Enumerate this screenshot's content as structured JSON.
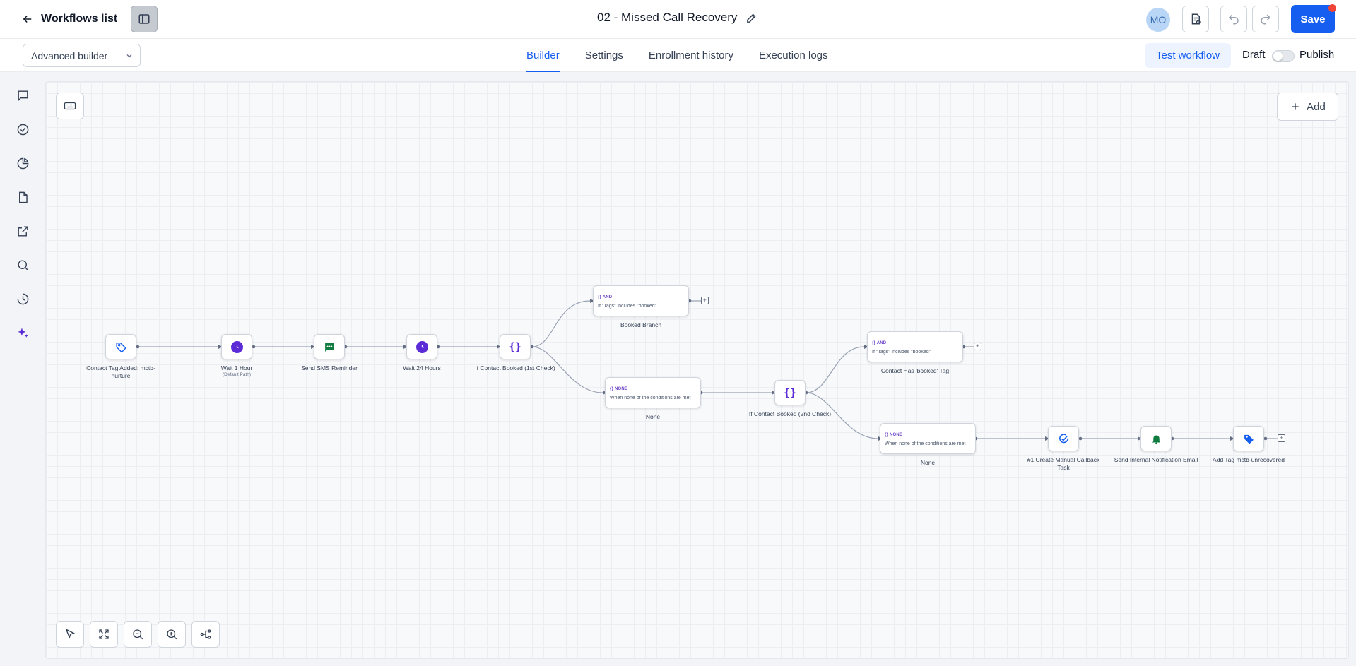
{
  "header": {
    "back_label": "Workflows list",
    "workflow_title": "02 - Missed Call Recovery",
    "avatar_initials": "MO",
    "save_label": "Save"
  },
  "subbar": {
    "builder_select": "Advanced builder",
    "tabs": [
      {
        "label": "Builder",
        "active": true
      },
      {
        "label": "Settings",
        "active": false
      },
      {
        "label": "Enrollment history",
        "active": false
      },
      {
        "label": "Execution logs",
        "active": false
      }
    ],
    "test_label": "Test workflow",
    "draft_label": "Draft",
    "publish_label": "Publish",
    "published": false
  },
  "canvas": {
    "add_label": "Add"
  },
  "nodes": {
    "n1": {
      "label": "Contact Tag Added: mctb-nurture",
      "icon": "tag-icon"
    },
    "n2": {
      "label": "Wait 1 Hour",
      "sub": "(Default Path)",
      "icon": "clock-icon"
    },
    "n3": {
      "label": "Send SMS Reminder",
      "icon": "sms-icon"
    },
    "n4": {
      "label": "Wait 24 Hours",
      "icon": "clock-icon"
    },
    "n5": {
      "label": "If Contact Booked (1st Check)",
      "icon": "braces-icon"
    },
    "c1": {
      "badge": "AND",
      "text": "If \"Tags\" includes \"booked\"",
      "label": "Booked Branch"
    },
    "c2": {
      "badge": "NONE",
      "text": "When none of the conditions are met",
      "label": "None"
    },
    "n6": {
      "label": "If Contact Booked (2nd Check)",
      "icon": "braces-icon"
    },
    "c3": {
      "badge": "AND",
      "text": "If \"Tags\" includes \"booked\"",
      "label": "Contact Has 'booked' Tag"
    },
    "c4": {
      "badge": "NONE",
      "text": "When none of the conditions are met",
      "label": "None"
    },
    "n7": {
      "label": "#1 Create Manual Callback Task",
      "icon": "task-check-icon"
    },
    "n8": {
      "label": "Send Internal Notification Email",
      "icon": "bell-icon"
    },
    "n9": {
      "label": "Add Tag mctb-unrecovered",
      "icon": "tag-filled-icon"
    }
  },
  "colors": {
    "accent": "#155eef",
    "purple": "#5b2bd6",
    "green": "#0f7b3f"
  }
}
